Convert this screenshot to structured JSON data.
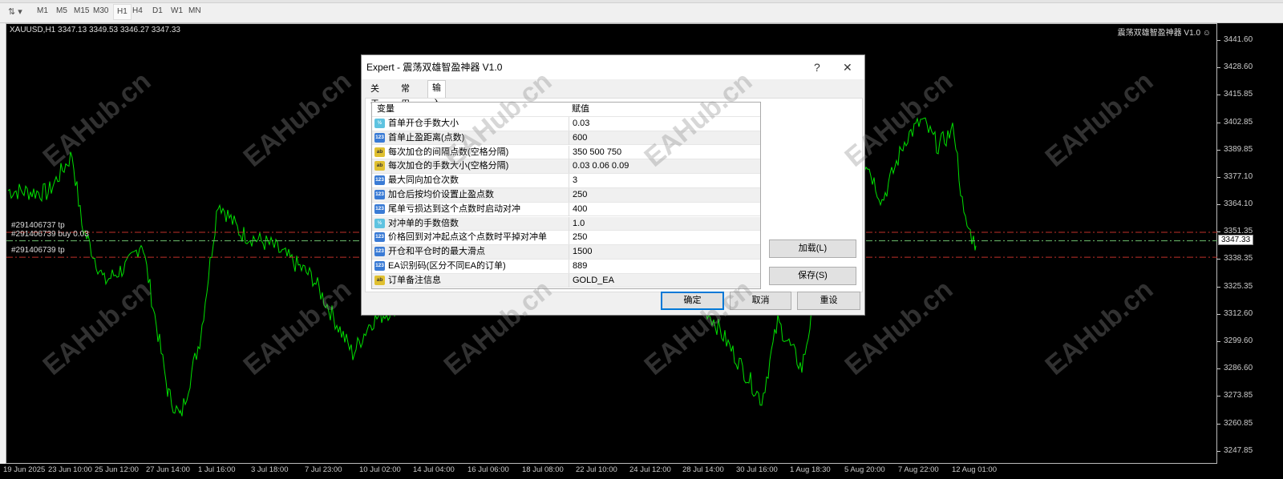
{
  "toolbar": {
    "timeframes": [
      "M1",
      "M5",
      "M15",
      "M30",
      "H1",
      "H4",
      "D1",
      "W1",
      "MN"
    ],
    "active": "H1"
  },
  "chart": {
    "symbol_line": "XAUUSD,H1  3347.13 3349.53 3346.27 3347.33",
    "ea_label": "震荡双雄智盈神器 V1.0 ☺",
    "current_price": "3347.33",
    "orders": [
      {
        "label": "#291406737 tp",
        "price": 3351.35,
        "color": "#c0302a"
      },
      {
        "label": "#291406739 buy 0.03",
        "price": 3347.33,
        "color": "#6dbf6d"
      },
      {
        "label": "#291406739 tp",
        "price": 3339.6,
        "color": "#c0302a"
      }
    ],
    "watermark": "EAHub.cn"
  },
  "chart_data": {
    "type": "line",
    "title": "XAUUSD,H1",
    "line_color": "#00e000",
    "ylim": [
      3247.85,
      3441.6
    ],
    "yticks": [
      "3441.60",
      "3428.60",
      "3415.85",
      "3402.85",
      "3389.85",
      "3377.10",
      "3364.10",
      "3351.35",
      "3338.35",
      "3325.35",
      "3312.60",
      "3299.60",
      "3286.60",
      "3273.85",
      "3260.85",
      "3247.85"
    ],
    "xticks": [
      "19 Jun 2025",
      "23 Jun 10:00",
      "25 Jun 12:00",
      "27 Jun 14:00",
      "1 Jul 16:00",
      "3 Jul 18:00",
      "7 Jul 23:00",
      "10 Jul 02:00",
      "14 Jul 04:00",
      "16 Jul 06:00",
      "18 Jul 08:00",
      "22 Jul 10:00",
      "24 Jul 12:00",
      "28 Jul 14:00",
      "30 Jul 16:00",
      "1 Aug 18:30",
      "5 Aug 20:00",
      "7 Aug 22:00",
      "12 Aug 01:00"
    ],
    "series": [
      {
        "name": "XAUUSD close",
        "x": [
          0,
          50,
          80,
          92,
          120,
          150,
          167,
          200,
          215,
          240,
          262,
          290,
          330,
          380,
          430,
          452,
          500,
          560,
          620,
          680,
          740,
          800,
          860,
          880,
          940,
          960,
          990,
          1010,
          1070,
          1090,
          1120,
          1140,
          1160,
          1180,
          1192,
          1207
        ],
        "y": [
          3371,
          3370,
          3388,
          3355,
          3328,
          3336,
          3347,
          3275,
          3264,
          3302,
          3366,
          3351,
          3345,
          3330,
          3294,
          3309,
          3320,
          3335,
          3340,
          3325,
          3318,
          3330,
          3320,
          3310,
          3272,
          3309,
          3287,
          3328,
          3385,
          3366,
          3396,
          3404,
          3392,
          3400,
          3358,
          3345
        ]
      }
    ]
  },
  "dialog": {
    "title": "Expert - 震荡双雄智盈神器 V1.0",
    "help": "?",
    "close": "✕",
    "tabs": [
      "关于",
      "常用",
      "输入参数"
    ],
    "active_tab": "输入参数",
    "table": {
      "headers": [
        "变量",
        "赋值"
      ],
      "rows": [
        {
          "type": "dbl",
          "icon": "½",
          "name": "首单开仓手数大小",
          "value": "0.03"
        },
        {
          "type": "num",
          "icon": "123",
          "name": "首单止盈距离(点数)",
          "value": "600"
        },
        {
          "type": "str",
          "icon": "ab",
          "name": "每次加仓的间隔点数(空格分隔)",
          "value": "350 500 750"
        },
        {
          "type": "str",
          "icon": "ab",
          "name": "每次加仓的手数大小(空格分隔)",
          "value": "0.03 0.06 0.09"
        },
        {
          "type": "num",
          "icon": "123",
          "name": "最大同向加仓次数",
          "value": "3"
        },
        {
          "type": "num",
          "icon": "123",
          "name": "加仓后按均价设置止盈点数",
          "value": "250"
        },
        {
          "type": "num",
          "icon": "123",
          "name": "尾单亏损达到这个点数时启动对冲",
          "value": "400"
        },
        {
          "type": "dbl",
          "icon": "½",
          "name": "对冲单的手数倍数",
          "value": "1.0"
        },
        {
          "type": "num",
          "icon": "123",
          "name": "价格回到对冲起点这个点数时平掉对冲单",
          "value": "250"
        },
        {
          "type": "num",
          "icon": "123",
          "name": "开仓和平仓时的最大滑点",
          "value": "1500"
        },
        {
          "type": "num",
          "icon": "123",
          "name": "EA识别码(区分不同EA的订单)",
          "value": "889"
        },
        {
          "type": "str",
          "icon": "ab",
          "name": "订单备注信息",
          "value": "GOLD_EA"
        }
      ]
    },
    "buttons": {
      "load": "加载(L)",
      "save": "保存(S)",
      "ok": "确定",
      "cancel": "取消",
      "reset": "重设"
    }
  }
}
